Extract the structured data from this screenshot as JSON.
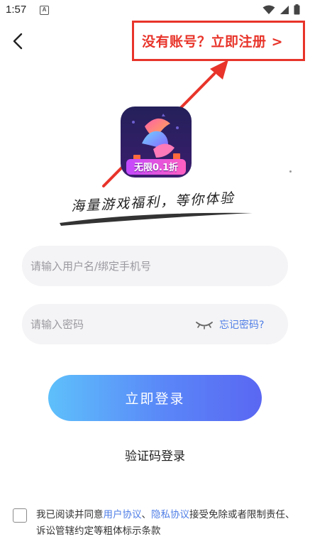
{
  "status_bar": {
    "time": "1:57",
    "app_icon_letter": "A"
  },
  "header": {
    "signup_link": "没有账号？立即注册 >"
  },
  "logo": {
    "badge_text": "无限0.1折"
  },
  "slogan": "海量游戏福利，等你体验",
  "form": {
    "username_placeholder": "请输入用户名/绑定手机号",
    "password_placeholder": "请输入密码",
    "forgot_password": "忘记密码?",
    "login_button": "立即登录",
    "code_login": "验证码登录"
  },
  "agreement": {
    "prefix": "我已阅读并同意",
    "user_agreement": "用户协议",
    "separator": "、",
    "privacy_agreement": "隐私协议",
    "suffix": "接受免除或者限制责任、诉讼管辖约定等粗体标示条款"
  },
  "colors": {
    "accent_red": "#e8342a",
    "link_blue": "#4f7ee6",
    "button_gradient_start": "#5ec0fb",
    "button_gradient_end": "#5a67f2"
  }
}
